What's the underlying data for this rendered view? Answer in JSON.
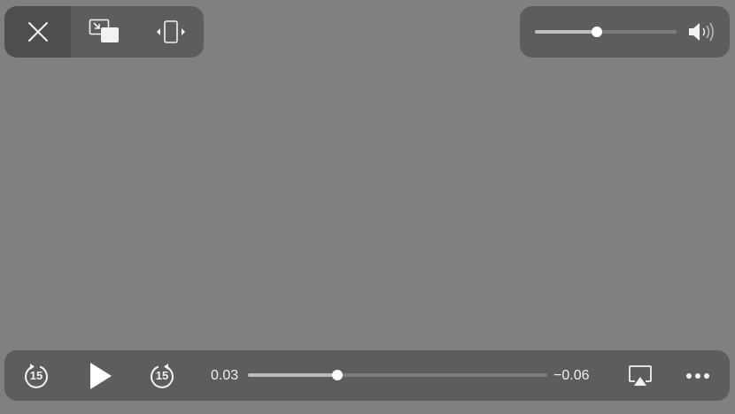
{
  "top_controls": {
    "close_icon": "close-icon",
    "pip_icon": "picture-in-picture-icon",
    "fit_icon": "aspect-fit-icon"
  },
  "volume": {
    "level": 0.44,
    "icon": "speaker-volume-icon"
  },
  "playback": {
    "skip_back_label": "15",
    "skip_forward_label": "15",
    "elapsed": "0.03",
    "remaining": "−0.06",
    "progress": 0.3,
    "play_icon": "play-icon",
    "airplay_icon": "airplay-icon",
    "more_icon": "more-icon"
  }
}
